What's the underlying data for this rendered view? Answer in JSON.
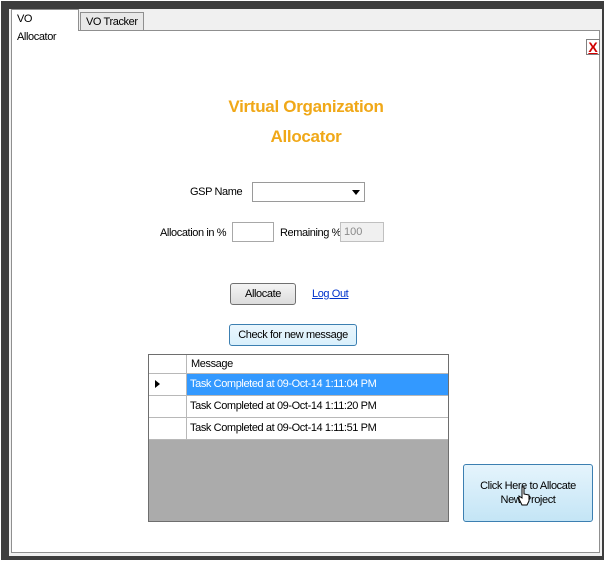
{
  "tabs": [
    {
      "label": "VO Allocator",
      "active": true
    },
    {
      "label": "VO Tracker",
      "active": false
    }
  ],
  "close_label": "X",
  "title_line1": "Virtual Organization",
  "title_line2": "Allocator",
  "form": {
    "gsp_label": "GSP Name",
    "gsp_value": "",
    "allocation_label": "Allocation in %",
    "allocation_value": "",
    "remaining_label": "Remaining %",
    "remaining_value": "100"
  },
  "buttons": {
    "allocate": "Allocate",
    "logout": "Log Out",
    "check_messages": "Check for new message",
    "new_project_line1": "Click Here to Allocate",
    "new_project_line2": "New Project"
  },
  "grid": {
    "column_header": "Message",
    "rows": [
      {
        "message": "Task Completed at 09-Oct-14 1:11:04 PM",
        "selected": true
      },
      {
        "message": "Task Completed at 09-Oct-14 1:11:20 PM",
        "selected": false
      },
      {
        "message": "Task Completed at 09-Oct-14 1:11:51 PM",
        "selected": false
      }
    ]
  },
  "colors": {
    "title": "#f0a818",
    "selection": "#3399ff",
    "link": "#0033cc",
    "close": "#d00000"
  }
}
